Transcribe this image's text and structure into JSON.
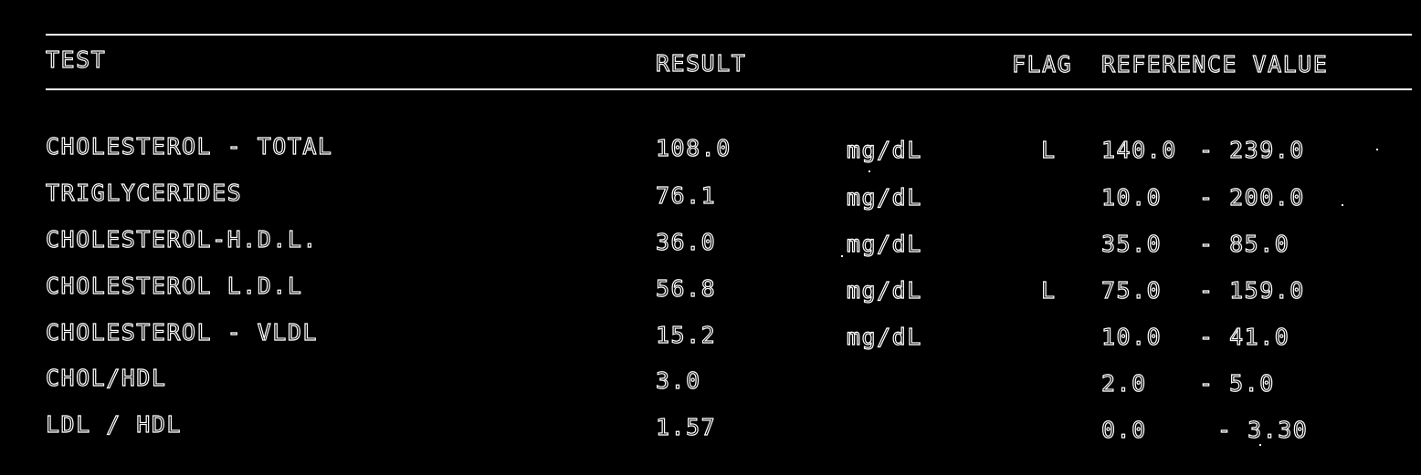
{
  "headers": {
    "test": "TEST",
    "result": "RESULT",
    "flag": "FLAG",
    "reference": "REFERENCE VALUE"
  },
  "rows": [
    {
      "test": "CHOLESTEROL - TOTAL",
      "result": "108.0",
      "unit": "mg/dL",
      "flag": "L",
      "ref_low": "140.0",
      "ref_high": "- 239.0"
    },
    {
      "test": "TRIGLYCERIDES",
      "result": "76.1",
      "unit": "mg/dL",
      "flag": "",
      "ref_low": "10.0",
      "ref_high": "- 200.0"
    },
    {
      "test": "CHOLESTEROL-H.D.L.",
      "result": "36.0",
      "unit": "mg/dL",
      "flag": "",
      "ref_low": "35.0",
      "ref_high": "- 85.0"
    },
    {
      "test": "CHOLESTEROL L.D.L",
      "result": "56.8",
      "unit": "mg/dL",
      "flag": "L",
      "ref_low": "75.0",
      "ref_high": "- 159.0"
    },
    {
      "test": "CHOLESTEROL - VLDL",
      "result": "15.2",
      "unit": "mg/dL",
      "flag": "",
      "ref_low": "10.0",
      "ref_high": "- 41.0"
    },
    {
      "test": "CHOL/HDL",
      "result": "3.0",
      "unit": "",
      "flag": "",
      "ref_low": "2.0",
      "ref_high": "- 5.0"
    },
    {
      "test": "LDL / HDL",
      "result": "1.57",
      "unit": "",
      "flag": "",
      "ref_low": "0.0",
      "ref_high": "- 3.30"
    }
  ]
}
